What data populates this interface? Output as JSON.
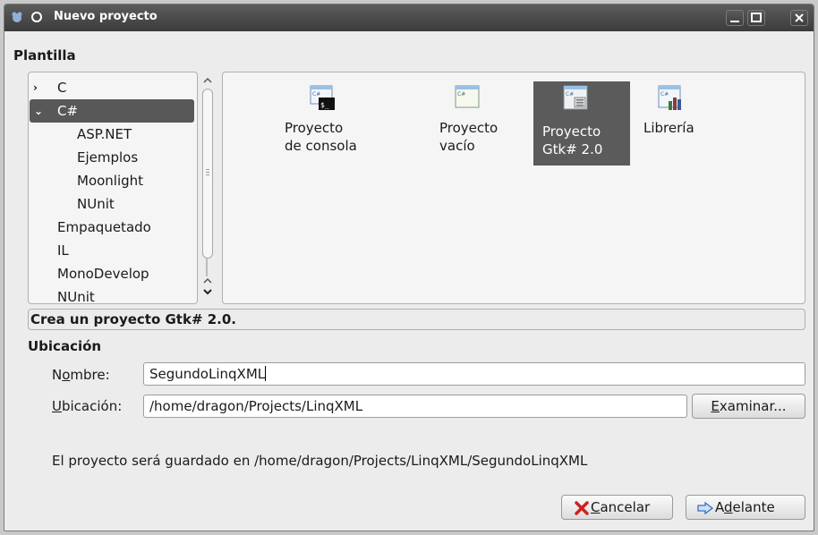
{
  "window": {
    "title": "Nuevo proyecto"
  },
  "template_section": {
    "heading": "Plantilla",
    "tree": [
      {
        "label": "C",
        "expanded": false,
        "level": 0
      },
      {
        "label": "C#",
        "expanded": true,
        "level": 0,
        "selected": true
      },
      {
        "label": "ASP.NET",
        "level": 1
      },
      {
        "label": "Ejemplos",
        "level": 1
      },
      {
        "label": "Moonlight",
        "level": 1
      },
      {
        "label": "NUnit",
        "level": 1
      },
      {
        "label": "Empaquetado",
        "level": 0
      },
      {
        "label": "IL",
        "level": 0
      },
      {
        "label": "MonoDevelop",
        "level": 0
      },
      {
        "label": "NUnit",
        "level": 0
      }
    ],
    "templates": [
      {
        "line1": "Proyecto",
        "line2": "de consola",
        "icon": "console-project-icon"
      },
      {
        "line1": "Proyecto",
        "line2": "vacío",
        "icon": "empty-project-icon"
      },
      {
        "line1": "Proyecto",
        "line2": "Gtk# 2.0",
        "icon": "gtk-project-icon",
        "selected": true
      },
      {
        "line1": "Librería",
        "line2": "",
        "icon": "library-project-icon"
      }
    ],
    "description": "Crea un proyecto Gtk# 2.0."
  },
  "location_section": {
    "heading": "Ubicación",
    "name_label_pre": "N",
    "name_label_mnemonic": "o",
    "name_label_post": "mbre:",
    "name_value": "SegundoLinqXML",
    "location_label_mnemonic": "U",
    "location_label_post": "bicación:",
    "location_value": "/home/dragon/Projects/LinqXML",
    "browse_mnemonic": "E",
    "browse_post": "xaminar...",
    "save_note": "El proyecto será guardado en /home/dragon/Projects/LinqXML/SegundoLinqXML"
  },
  "buttons": {
    "cancel_mnemonic": "C",
    "cancel_post": "ancelar",
    "next_pre": "A",
    "next_mnemonic": "d",
    "next_post": "elante"
  },
  "colors": {
    "selection": "#585858",
    "titlebar": "#3b3b3b",
    "cancel_icon": "#d02020",
    "next_icon": "#3a6fc4"
  }
}
